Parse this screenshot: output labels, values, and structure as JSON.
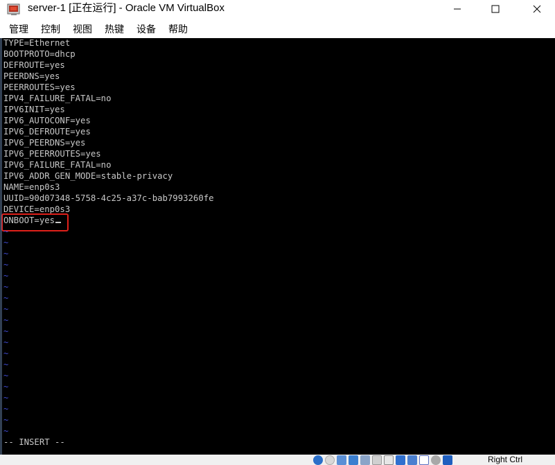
{
  "window": {
    "title": "server-1 [正在运行] - Oracle VM VirtualBox"
  },
  "menu": {
    "items": [
      "管理",
      "控制",
      "视图",
      "热键",
      "设备",
      "帮助"
    ]
  },
  "terminal": {
    "lines": [
      "TYPE=Ethernet",
      "BOOTPROTO=dhcp",
      "DEFROUTE=yes",
      "PEERDNS=yes",
      "PEERROUTES=yes",
      "IPV4_FAILURE_FATAL=no",
      "IPV6INIT=yes",
      "IPV6_AUTOCONF=yes",
      "IPV6_DEFROUTE=yes",
      "IPV6_PEERDNS=yes",
      "IPV6_PEERROUTES=yes",
      "IPV6_FAILURE_FATAL=no",
      "IPV6_ADDR_GEN_MODE=stable-privacy",
      "NAME=enp0s3",
      "UUID=90d07348-5758-4c25-a37c-bab7993260fe",
      "DEVICE=enp0s3",
      "ONBOOT=yes"
    ],
    "empty_line_marker": "~",
    "mode_indicator": "-- INSERT --"
  },
  "status_bar": {
    "host_key": "Right Ctrl"
  },
  "colors": {
    "terminal_bg": "#000000",
    "terminal_fg": "#c8c8c8",
    "tilde": "#3f4bd1",
    "highlight_box": "#e0201a"
  }
}
